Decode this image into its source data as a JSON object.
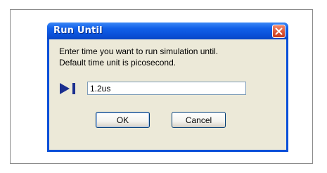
{
  "dialog": {
    "title": "Run Until",
    "close_icon": "close-icon",
    "message_line1": "Enter time you want to run simulation until.",
    "message_line2": "Default time unit is picosecond.",
    "run_icon": "run-to-icon",
    "time_input_value": "1.2us",
    "ok_label": "OK",
    "cancel_label": "Cancel"
  },
  "colors": {
    "titlebar": "#0a50d8",
    "client_background": "#ece9d8",
    "close_button": "#df5a3a",
    "run_icon": "#1b2f8f"
  }
}
